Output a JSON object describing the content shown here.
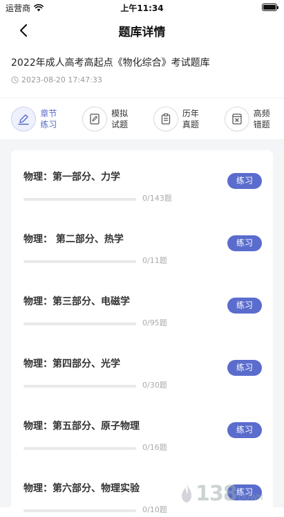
{
  "status_bar": {
    "carrier": "运营商",
    "time": "上午11:34"
  },
  "nav": {
    "title": "题库详情"
  },
  "bank": {
    "title": "2022年成人高考高起点《物化综合》考试题库",
    "date": "2023-08-20 17:47:33"
  },
  "tabs": [
    {
      "line1": "章节",
      "line2": "练习",
      "icon": "pencil-icon",
      "active": true
    },
    {
      "line1": "模拟",
      "line2": "试题",
      "icon": "exam-paper-icon",
      "active": false
    },
    {
      "line1": "历年",
      "line2": "真题",
      "icon": "clipboard-icon",
      "active": false
    },
    {
      "line1": "高频",
      "line2": "错题",
      "icon": "wrong-answer-icon",
      "active": false
    }
  ],
  "chapters": [
    {
      "name": "物理：第一部分、力学",
      "progress": "0/143题",
      "done": 0,
      "total": 143,
      "button": "练习"
    },
    {
      "name": "物理： 第二部分、热学",
      "progress": "0/11题",
      "done": 0,
      "total": 11,
      "button": "练习"
    },
    {
      "name": "物理：第三部分、电磁学",
      "progress": "0/95题",
      "done": 0,
      "total": 95,
      "button": "练习"
    },
    {
      "name": "物理：第四部分、光学",
      "progress": "0/30题",
      "done": 0,
      "total": 30,
      "button": "练习"
    },
    {
      "name": "物理：第五部分、原子物理",
      "progress": "0/16题",
      "done": 0,
      "total": 16,
      "button": "练习"
    },
    {
      "name": "物理：第六部分、物理实验",
      "progress": "0/10题",
      "done": 0,
      "total": 10,
      "button": "练习"
    }
  ],
  "watermark": {
    "text": "138",
    "sub": "DOWN"
  },
  "colors": {
    "accent": "#5568c7",
    "button": "#5a6ccc",
    "background": "#f4f5f7"
  }
}
